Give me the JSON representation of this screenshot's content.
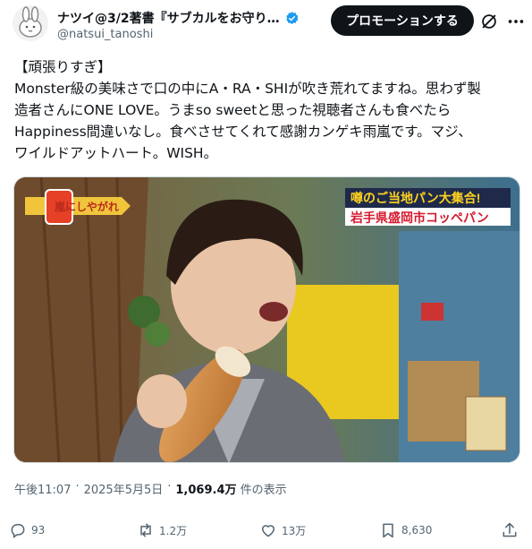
{
  "author": {
    "display_name": "ナツイ@3/2著書『サブカルをお守り…",
    "handle": "@natsui_tanoshi"
  },
  "promote_button_label": "プロモーションする",
  "tweet": {
    "lines": [
      "【頑張りすぎ】",
      "Monster級の美味さで口の中にA・RA・SHIが吹き荒れてますね。思わず製",
      "造者さんにONE LOVE。うまso sweetと思った視聴者さんも食べたら",
      "Happiness間違いなし。食べさせてくれて感謝カンゲキ雨嵐です。マジ、",
      "ワイルドアットハート。WISH。"
    ]
  },
  "media": {
    "show_logo": "嵐にしやがれ",
    "banner_line1": "噂のご当地パン大集合!",
    "banner_line2": "岩手県盛岡市コッペパン"
  },
  "meta": {
    "time": "午後11:07",
    "separator1": "·",
    "date": "2025年5月5日",
    "separator2": "·",
    "views_count": "1,069.4万",
    "views_label": "件の表示"
  },
  "actions": {
    "replies": "93",
    "reposts": "1.2万",
    "likes": "13万",
    "bookmarks": "8,630"
  },
  "colors": {
    "verified": "#1d9bf0",
    "text": "#0f1419",
    "secondary": "#536471",
    "promo_bg": "#0f1419"
  },
  "icons": [
    "avatar-rabbit",
    "verified-badge-icon",
    "grok-icon",
    "more-icon",
    "reply-icon",
    "repost-icon",
    "like-icon",
    "bookmark-icon",
    "share-icon"
  ]
}
